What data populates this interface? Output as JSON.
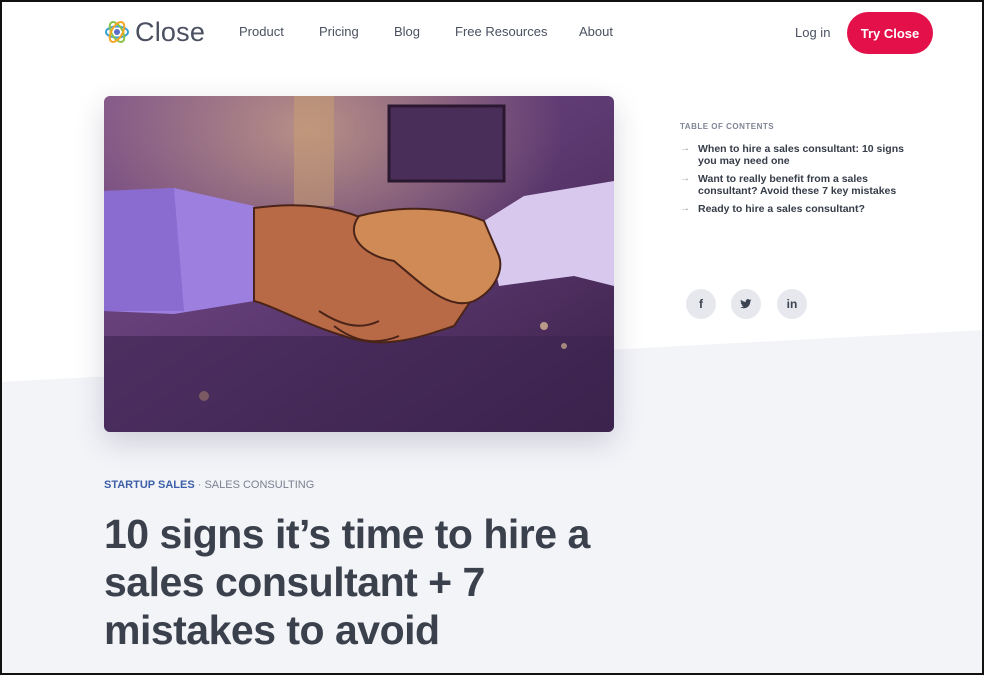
{
  "header": {
    "logo_text": "Close",
    "nav": [
      "Product",
      "Pricing",
      "Blog",
      "Free Resources",
      "About"
    ],
    "login_label": "Log in",
    "cta_label": "Try Close"
  },
  "toc": {
    "title": "TABLE OF CONTENTS",
    "items": [
      "When to hire a sales consultant: 10 signs you may need one",
      "Want to really benefit from a sales consultant? Avoid these 7 key mistakes",
      "Ready to hire a sales consultant?"
    ]
  },
  "social": {
    "facebook": "f",
    "twitter_icon": "twitter-icon",
    "linkedin": "in"
  },
  "article": {
    "category_primary": "STARTUP SALES",
    "separator": " · ",
    "category_secondary": "SALES CONSULTING",
    "title": "10 signs it’s time to hire a sales consultant + 7 mistakes to avoid"
  },
  "colors": {
    "accent": "#e4104a",
    "category": "#3c5fa8",
    "slant_bg": "#f3f4f8"
  }
}
